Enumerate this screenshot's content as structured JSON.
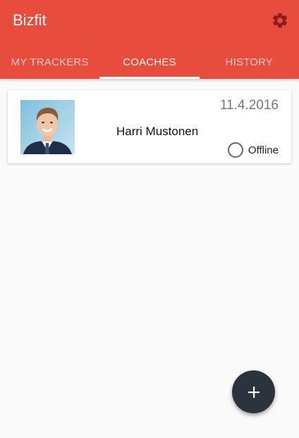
{
  "app": {
    "title": "Bizfit"
  },
  "tabs": [
    {
      "label": "MY TRACKERS",
      "active": false
    },
    {
      "label": "COACHES",
      "active": true
    },
    {
      "label": "HISTORY",
      "active": false
    }
  ],
  "coaches": [
    {
      "name": "Harri Mustonen",
      "date": "11.4.2016",
      "status": "Offline"
    }
  ],
  "icons": {
    "settings": "gear-icon",
    "fab": "plus-icon",
    "status": "circle-outline-icon"
  },
  "colors": {
    "primary": "#e84c3d",
    "fab": "#2b333d",
    "background": "#fafafa"
  }
}
